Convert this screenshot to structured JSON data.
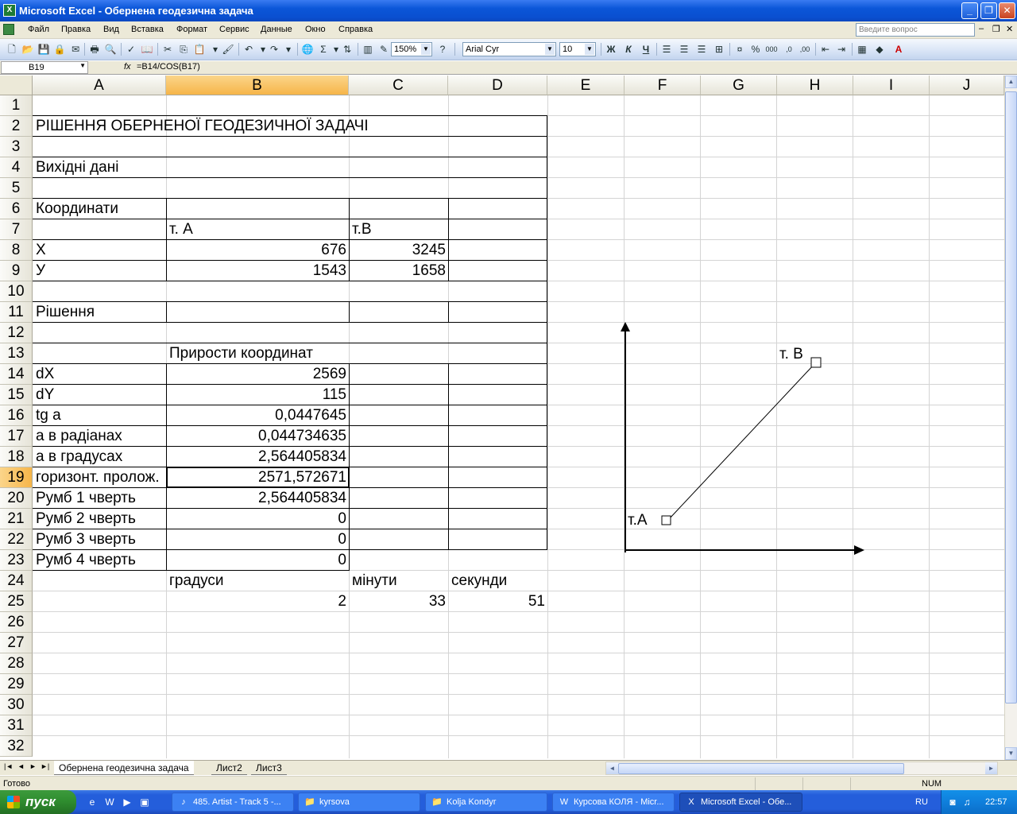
{
  "window": {
    "title": "Microsoft Excel - Обернена геодезична задача"
  },
  "menu": [
    "Файл",
    "Правка",
    "Вид",
    "Вставка",
    "Формат",
    "Сервис",
    "Данные",
    "Окно",
    "Справка"
  ],
  "ask_placeholder": "Введите вопрос",
  "toolbar": {
    "zoom": "150%",
    "font": "Arial Cyr",
    "size": "10",
    "bold": "Ж",
    "italic": "К",
    "underline": "Ч"
  },
  "formula_bar": {
    "name": "B19",
    "fx": "fx",
    "formula": "=B14/COS(B17)"
  },
  "columns": [
    "A",
    "B",
    "C",
    "D",
    "E",
    "F",
    "G",
    "H",
    "I",
    "J"
  ],
  "rows": [
    "1",
    "2",
    "3",
    "4",
    "5",
    "6",
    "7",
    "8",
    "9",
    "10",
    "11",
    "12",
    "13",
    "14",
    "15",
    "16",
    "17",
    "18",
    "19",
    "20",
    "21",
    "22",
    "23",
    "24",
    "25",
    "26",
    "27",
    "28",
    "29",
    "30",
    "31",
    "32"
  ],
  "cells": {
    "A2": "РІШЕННЯ ОБЕРНЕНОЇ ГЕОДЕЗИЧНОЇ ЗАДАЧІ",
    "A4": "Вихідні дані",
    "A6": "Координати",
    "B7": "т. А",
    "C7": "т.В",
    "A8": "Х",
    "B8": "676",
    "C8": "3245",
    "A9": "У",
    "B9": "1543",
    "C9": "1658",
    "A11": "Рішення",
    "B13": "Прирости координат",
    "A14": "dX",
    "B14": "2569",
    "A15": "dY",
    "B15": "115",
    "A16": "tg a",
    "B16": "0,0447645",
    "A17": "a в радіанах",
    "B17": "0,044734635",
    "A18": "a в градусах",
    "B18": "2,564405834",
    "A19": "горизонт. пролож.",
    "B19": "2571,572671",
    "A20": "Румб 1 чверть",
    "B20": "2,564405834",
    "A21": "Румб 2 чверть",
    "B21": "0",
    "A22": "Румб 3 чверть",
    "B22": "0",
    "A23": "Румб 4 чверть",
    "B23": "0",
    "B24": "градуси",
    "C24": "мінути",
    "D24": "секунди",
    "B25": "2",
    "C25": "33",
    "D25": "51"
  },
  "drawing": {
    "point_a": "т.А",
    "point_b": "т. В"
  },
  "sheets": [
    "Обернена геодезична задача",
    "Лист2",
    "Лист3"
  ],
  "status": {
    "ready": "Готово",
    "num": "NUM"
  },
  "taskbar": {
    "start": "пуск",
    "tasks": [
      "485. Artist - Track 5 -...",
      "kyrsova",
      "Kolja Kondyr",
      "Курсова КОЛЯ - Micr...",
      "Microsoft Excel - Обе..."
    ],
    "lang": "RU",
    "clock": "22:57"
  }
}
